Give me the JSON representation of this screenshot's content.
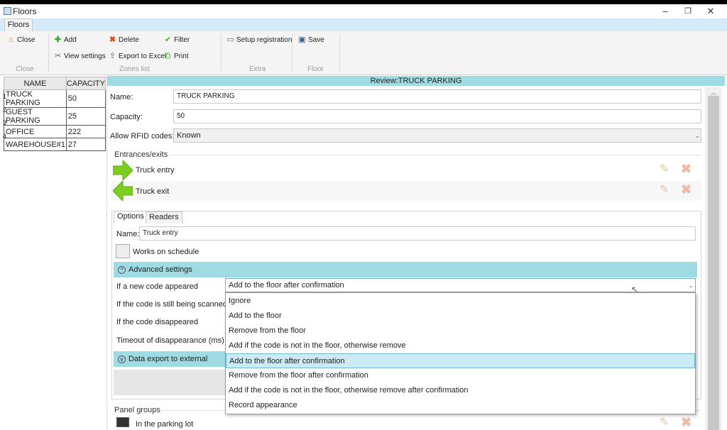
{
  "window": {
    "title": "Floors",
    "minimize": "–",
    "restore": "❐",
    "close": "✕"
  },
  "ribbon_tab": "Floors",
  "ribbon": {
    "close": "Close",
    "add": "Add",
    "delete": "Delete",
    "filter": "Filter",
    "view_settings": "View settings",
    "export_excel": "Export to Excel",
    "print": "Print",
    "setup_registration": "Setup registration",
    "save": "Save",
    "groups": [
      "Close",
      "Zones list",
      "Extra",
      "Floor"
    ]
  },
  "grid": {
    "columns": [
      "NAME",
      "CAPACITY"
    ],
    "rows": [
      {
        "num": "1",
        "name": "TRUCK PARKING",
        "capacity": "50"
      },
      {
        "num": "2",
        "name": "GUEST PARKING",
        "capacity": "25"
      },
      {
        "num": "3",
        "name": "OFFICE",
        "capacity": "222"
      },
      {
        "num": "4",
        "name": "WAREHOUSE#1",
        "capacity": "27"
      }
    ]
  },
  "review_header": "Review:TRUCK PARKING",
  "form": {
    "name_label": "Name:",
    "name_value": "TRUCK PARKING",
    "capacity_label": "Capacity:",
    "capacity_value": "50",
    "rfid_label": "Allow RFID codes:",
    "rfid_value": "Known"
  },
  "entrances": {
    "title": "Entrances/exits",
    "items": [
      "Truck entry",
      "Truck exit"
    ]
  },
  "options": {
    "tabs": [
      "Options",
      "Readers"
    ],
    "name_label": "Name:",
    "name_value": "Truck entry",
    "schedule_label": "Works on schedule",
    "advanced_label": "Advanced settings",
    "new_code_label": "If a new code appeared",
    "new_code_value": "Add to the floor after confirmation",
    "still_scanned_label": "If the code is still being scanned",
    "disappeared_label": "If the code disappeared",
    "timeout_label": "Timeout of disappearance (ms)",
    "export_label": "Data export to external syster"
  },
  "dropdown_options": [
    "Ignore",
    "Add to the floor",
    "Remove from the floor",
    "Add if the code is not in the floor, otherwise remove",
    "Add to the floor after confirmation",
    "Remove from the floor after confirmation",
    "Add if the code is not in the floor, otherwise remove after confirmation",
    "Record appearance"
  ],
  "panel_groups": {
    "title": "Panel groups",
    "item": "In the parking lot"
  },
  "colors": {
    "teal_header": "#9fdbe3",
    "selected_option": "#cbeaf3",
    "arrow_green": "#7ccf1f"
  }
}
